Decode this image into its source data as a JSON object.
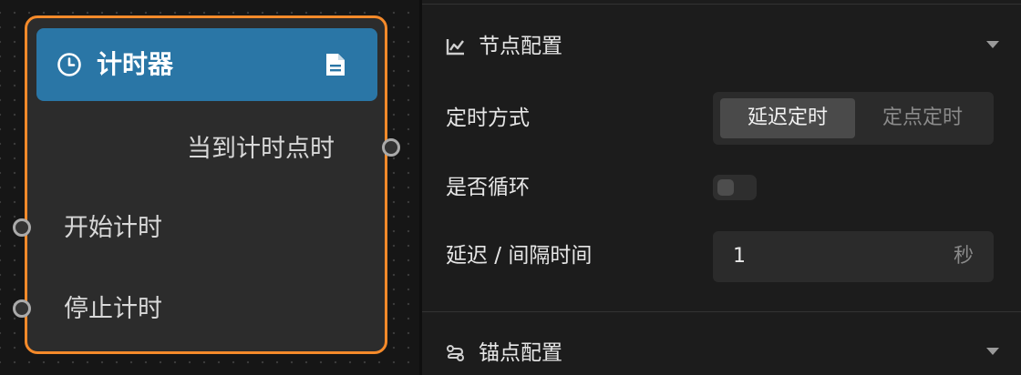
{
  "node": {
    "title": "计时器",
    "icon": "clock-icon",
    "doc_icon": "document-icon",
    "output_port_label": "当到计时点时",
    "input_ports": [
      "开始计时",
      "停止计时"
    ],
    "border_color": "#f58a2a",
    "header_color": "#2a76a6"
  },
  "panel": {
    "node_config": {
      "title": "节点配置",
      "timer_mode_label": "定时方式",
      "timer_mode_options": [
        "延迟定时",
        "定点定时"
      ],
      "timer_mode_selected": "延迟定时",
      "loop_label": "是否循环",
      "loop_enabled": false,
      "interval_label": "延迟 / 间隔时间",
      "interval_value": "1",
      "interval_unit": "秒"
    },
    "anchor_config": {
      "title": "锚点配置"
    }
  }
}
